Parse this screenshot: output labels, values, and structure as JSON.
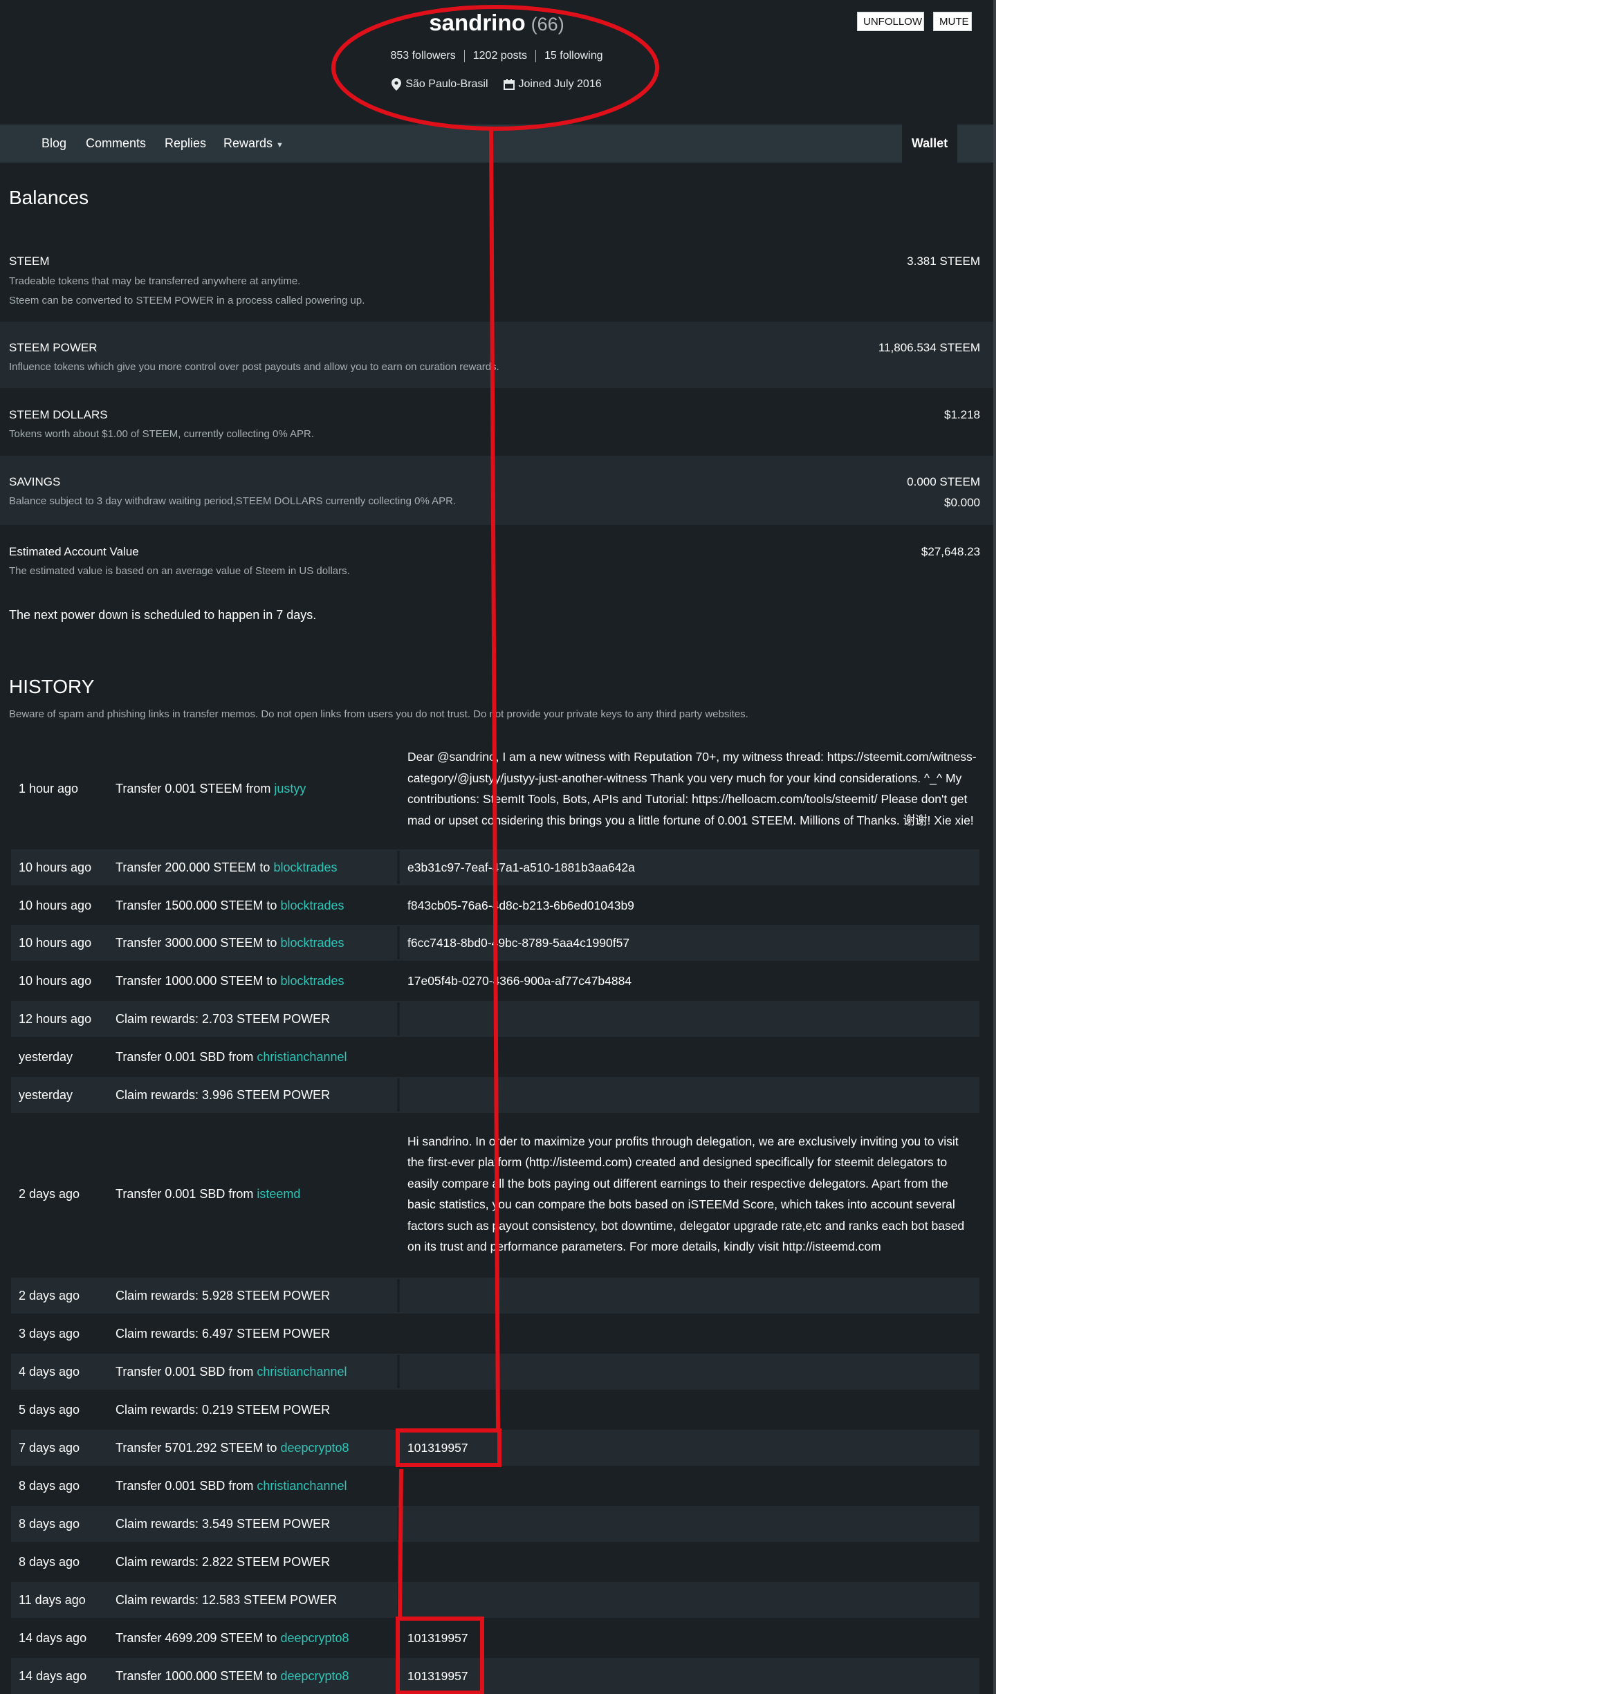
{
  "header": {
    "username": "sandrino",
    "reputation": "(66)",
    "followers": "853 followers",
    "posts": "1202 posts",
    "following": "15 following",
    "location": "São Paulo-Brasil",
    "joined": "Joined July 2016",
    "unfollow_label": "UNFOLLOW",
    "mute_label": "MUTE"
  },
  "nav": {
    "blog": "Blog",
    "comments": "Comments",
    "replies": "Replies",
    "rewards": "Rewards",
    "wallet": "Wallet"
  },
  "balances": {
    "heading": "Balances",
    "steem": {
      "title": "STEEM",
      "desc1": "Tradeable tokens that may be transferred anywhere at anytime.",
      "desc2": "Steem can be converted to STEEM POWER in a process called powering up.",
      "value": "3.381 STEEM"
    },
    "steem_power": {
      "title": "STEEM POWER",
      "desc": "Influence tokens which give you more control over post payouts and allow you to earn on curation rewards.",
      "value": "11,806.534 STEEM"
    },
    "steem_dollars": {
      "title": "STEEM DOLLARS",
      "desc": "Tokens worth about $1.00 of STEEM, currently collecting 0% APR.",
      "value": "$1.218"
    },
    "savings": {
      "title": "SAVINGS",
      "desc": "Balance subject to 3 day withdraw waiting period,STEEM DOLLARS currently collecting 0% APR.",
      "value_steem": "0.000 STEEM",
      "value_sbd": "$0.000"
    },
    "estimated": {
      "title": "Estimated Account Value",
      "desc": "The estimated value is based on an average value of Steem in US dollars.",
      "value": "$27,648.23"
    },
    "power_down_note": "The next power down is scheduled to happen  in 7 days."
  },
  "history": {
    "heading": "HISTORY",
    "warning": "Beware of spam and phishing links in transfer memos. Do not open links from users you do not trust. Do not provide your private keys to any third party websites.",
    "rows": [
      {
        "time": "1 hour ago",
        "op": "Transfer 0.001 STEEM from",
        "account": "justyy",
        "memo": "Dear @sandrino, I am a new witness with Reputation 70+, my witness thread: https://steemit.com/witness-category/@justyy/justyy-just-another-witness Thank you very much for your kind considerations. ^_^ My contributions: SteemIt Tools, Bots, APIs and Tutorial: https://helloacm.com/tools/steemit/ Please don't get mad or upset considering this brings you a little fortune of 0.001 STEEM. Millions of Thanks. 谢谢! Xie xie!"
      },
      {
        "time": "10 hours ago",
        "op": "Transfer 200.000 STEEM to",
        "account": "blocktrades",
        "memo": "e3b31c97-7eaf-47a1-a510-1881b3aa642a"
      },
      {
        "time": "10 hours ago",
        "op": "Transfer 1500.000 STEEM to",
        "account": "blocktrades",
        "memo": "f843cb05-76a6-4d8c-b213-6b6ed01043b9"
      },
      {
        "time": "10 hours ago",
        "op": "Transfer 3000.000 STEEM to",
        "account": "blocktrades",
        "memo": "f6cc7418-8bd0-49bc-8789-5aa4c1990f57"
      },
      {
        "time": "10 hours ago",
        "op": "Transfer 1000.000 STEEM to",
        "account": "blocktrades",
        "memo": "17e05f4b-0270-4366-900a-af77c47b4884"
      },
      {
        "time": "12 hours ago",
        "op": "Claim rewards: 2.703 STEEM POWER",
        "account": "",
        "memo": ""
      },
      {
        "time": "yesterday",
        "op": "Transfer 0.001 SBD from",
        "account": "christianchannel",
        "memo": ""
      },
      {
        "time": "yesterday",
        "op": "Claim rewards: 3.996 STEEM POWER",
        "account": "",
        "memo": ""
      },
      {
        "time": "2 days ago",
        "op": "Transfer 0.001 SBD from",
        "account": "isteemd",
        "memo": "Hi sandrino. In order to maximize your profits through delegation, we are exclusively inviting you to visit the first-ever platform (http://isteemd.com) created and designed specifically for steemit delegators to easily compare all the bots paying out different earnings to their respective delegators. Apart from the basic statistics, you can compare the bots based on iSTEEMd Score, which takes into account several factors such as payout consistency, bot downtime, delegator upgrade rate,etc and ranks each bot based on its trust and performance parameters. For more details, kindly visit http://isteemd.com"
      },
      {
        "time": "2 days ago",
        "op": "Claim rewards: 5.928 STEEM POWER",
        "account": "",
        "memo": ""
      },
      {
        "time": "3 days ago",
        "op": "Claim rewards: 6.497 STEEM POWER",
        "account": "",
        "memo": ""
      },
      {
        "time": "4 days ago",
        "op": "Transfer 0.001 SBD from",
        "account": "christianchannel",
        "memo": ""
      },
      {
        "time": "5 days ago",
        "op": "Claim rewards: 0.219 STEEM POWER",
        "account": "",
        "memo": ""
      },
      {
        "time": "7 days ago",
        "op": "Transfer 5701.292 STEEM to",
        "account": "deepcrypto8",
        "memo": "101319957"
      },
      {
        "time": "8 days ago",
        "op": "Transfer 0.001 SBD from",
        "account": "christianchannel",
        "memo": ""
      },
      {
        "time": "8 days ago",
        "op": "Claim rewards: 3.549 STEEM POWER",
        "account": "",
        "memo": ""
      },
      {
        "time": "8 days ago",
        "op": "Claim rewards: 2.822 STEEM POWER",
        "account": "",
        "memo": ""
      },
      {
        "time": "11 days ago",
        "op": "Claim rewards: 12.583 STEEM POWER",
        "account": "",
        "memo": ""
      },
      {
        "time": "14 days ago",
        "op": "Transfer 4699.209 STEEM to",
        "account": "deepcrypto8",
        "memo": "101319957"
      },
      {
        "time": "14 days ago",
        "op": "Transfer 1000.000 STEEM to",
        "account": "deepcrypto8",
        "memo": "101319957"
      }
    ]
  },
  "colors": {
    "background": "#1a2024",
    "nav": "#2b353c",
    "link": "#2ec4b6",
    "annotation": "#e0101a"
  }
}
